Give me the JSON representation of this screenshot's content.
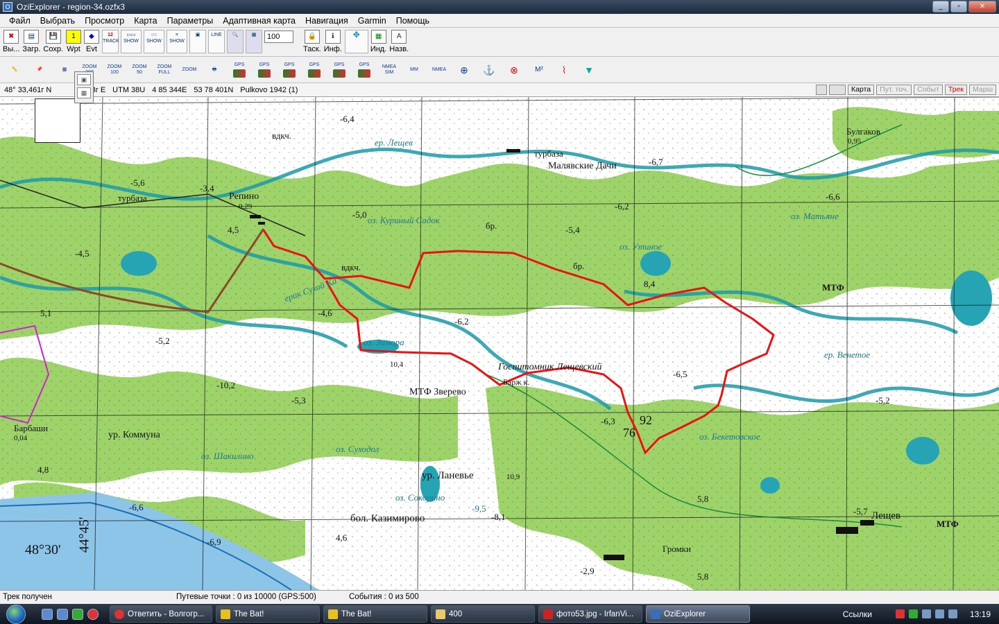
{
  "window": {
    "title": "OziExplorer - region-34.ozfx3"
  },
  "menu": [
    "Файл",
    "Выбрать",
    "Просмотр",
    "Карта",
    "Параметры",
    "Адаптивная карта",
    "Навигация",
    "Garmin",
    "Помощь"
  ],
  "toolbar1": {
    "exit": "Вы...",
    "load": "Загр.",
    "save": "Сохр.",
    "wpt": "Wpt",
    "evt": "Evt",
    "track": "TRACK",
    "show": "SHOW",
    "zoom_value": "100",
    "task": "Таск.",
    "info": "Инф.",
    "ind": "Инд.",
    "name": "Назв."
  },
  "toolbar2": {
    "zoom": [
      "ZOOM 200",
      "ZOOM 100",
      "ZOOM 50",
      "ZOOM FULL",
      "ZOOM"
    ],
    "gps": [
      "GPS",
      "GPS",
      "GPS",
      "GPS",
      "GPS",
      "GPS"
    ],
    "nmea": [
      "NMEA SIM",
      "MM",
      "NMEA"
    ]
  },
  "coordbar": {
    "lat": "48° 33,461г N",
    "lon": "...83г E",
    "utm": "UTM  38U",
    "east": "4 85 344E",
    "north": "53 78 401N",
    "datum": "Pulkovo 1942 (1)",
    "buttons": {
      "map": "Карта",
      "points": "Пут. точ.",
      "events": "Событ",
      "track": "Трек",
      "route": "Марш"
    }
  },
  "map": {
    "labels": [
      "-6,4",
      "ер. Лещев",
      "вдкч.",
      "турбаза",
      "Малявские Дачи",
      "-6,7",
      "Булгаков",
      "0,95",
      "Репино",
      "0,29",
      "-3,4",
      "турбаза",
      "-5,6",
      "-5,0",
      "оз. Куриный Садок",
      "бр.",
      "-5,4",
      "-6,2",
      "оз. Утиное",
      "-6,6",
      "оз. Матьяне",
      "4,5",
      "-4,5",
      "вдкч.",
      "бр.",
      "ерик Сухой Ка",
      "8,4",
      "МТФ",
      "-6,2",
      "5,1",
      "-4,6",
      "-5,2",
      "оз. Зимора",
      "10,4",
      "Госпитомник Лещевский",
      "Барж к.",
      "-6,5",
      "ер. Венетое",
      "-10,2",
      "МТФ Зверево",
      "-5,3",
      "-6,3",
      "92",
      "76",
      "оз. Бекетовское",
      "-5,2",
      "Барбаши",
      "0,04",
      "ур. Коммуна",
      "оз. Суходол",
      "оз. Шакилино",
      "ур. Ланевье",
      "4,8",
      "10,9",
      "-6,6",
      "оз. Сокорино",
      "бол. Казимирово",
      "-9,5",
      "-8,1",
      "5,8",
      "-5,7",
      "Лещев",
      "МТФ",
      "4,6",
      "-6,9",
      "48°30'",
      "44°45'",
      "Громки",
      "-2,9",
      "5,8"
    ]
  },
  "status": {
    "track": "Трек получен",
    "waypoints": "Путевые точки : 0 из 10000  (GPS:500)",
    "events": "События : 0 из 500"
  },
  "taskbar": {
    "tasks": [
      "Ответить - Волгогр...",
      "The Bat!",
      "The Bat!",
      "400",
      "фото53.jpg - IrfanVi...",
      "OziExplorer"
    ],
    "links": "Ссылки",
    "clock": "13:19"
  }
}
